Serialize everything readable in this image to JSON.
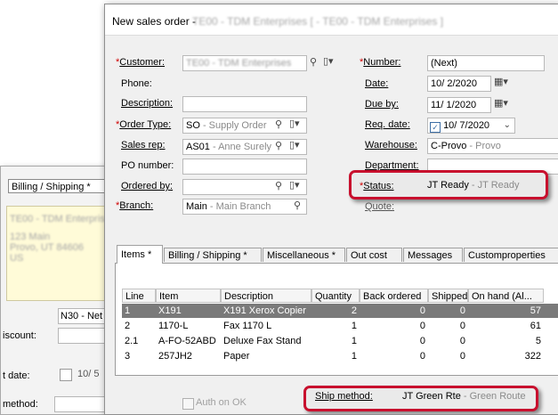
{
  "background_window": {
    "tab_label": "Billing / Shipping  *",
    "address_line1": "TE00 - TDM Enterprises",
    "address_line2": "123 Main",
    "address_line3": "Provo, UT 84606",
    "address_line4": "US",
    "terms_value": "N30 - Net",
    "discount_label": "iscount:",
    "date_label": "t date:",
    "date_value": "10/  5",
    "method_label": "method:",
    "auth_label": "Auth on OK"
  },
  "dialog": {
    "title": "New sales order - ",
    "title_blur": "TE00 - TDM Enterprises [ - TE00 - TDM Enterprises ]",
    "fields": {
      "customer": {
        "label": "Customer:",
        "value": "TE00 - TDM Enterprises"
      },
      "phone": {
        "label": "Phone:"
      },
      "description": {
        "label": "Description:",
        "value": ""
      },
      "order_type": {
        "label": "Order Type:",
        "code": "SO",
        "desc": " - Supply Order"
      },
      "sales_rep": {
        "label": "Sales rep:",
        "code": "AS01",
        "desc": " - Anne Surely"
      },
      "po_number": {
        "label": "PO number:",
        "value": ""
      },
      "ordered_by": {
        "label": "Ordered by:",
        "value": ""
      },
      "branch": {
        "label": "Branch:",
        "code": "Main",
        "desc": " - Main Branch"
      },
      "number": {
        "label": "Number:",
        "value": "(Next)"
      },
      "date": {
        "label": "Date:",
        "value": "10/  2/2020"
      },
      "due_by": {
        "label": "Due by:",
        "value": "11/  1/2020"
      },
      "req_date": {
        "label": "Req. date:",
        "value": "10/  7/2020"
      },
      "warehouse": {
        "label": "Warehouse:",
        "code": "C-Provo",
        "desc": " - Provo"
      },
      "department": {
        "label": "Department:",
        "value": ""
      },
      "status": {
        "label": "Status:",
        "code": "JT Ready",
        "desc": " - JT Ready"
      },
      "quote": {
        "label": "Quote:"
      },
      "ship_method": {
        "label": "Ship method:",
        "code": "JT Green Rte",
        "desc": " - Green Route"
      }
    },
    "tabs": [
      {
        "label": "Items  *"
      },
      {
        "label": "Billing / Shipping  *"
      },
      {
        "label": "Miscellaneous  *"
      },
      {
        "label": "Out cost"
      },
      {
        "label": "Messages"
      },
      {
        "label": "Customproperties"
      }
    ],
    "grid": {
      "columns": [
        "Line",
        "Item",
        "Description",
        "Quantity",
        "Back ordered",
        "Shipped",
        "On hand (Al..."
      ],
      "rows": [
        [
          "1",
          "X191",
          "X191 Xerox Copier",
          "2",
          "0",
          "0",
          "57"
        ],
        [
          "2",
          "1170-L",
          "Fax 1170 L",
          "1",
          "0",
          "0",
          "61"
        ],
        [
          "2.1",
          "A-FO-52ABD",
          "Deluxe Fax Stand",
          "1",
          "0",
          "0",
          "5"
        ],
        [
          "3",
          "257JH2",
          "Paper",
          "1",
          "0",
          "0",
          "322"
        ]
      ]
    }
  }
}
